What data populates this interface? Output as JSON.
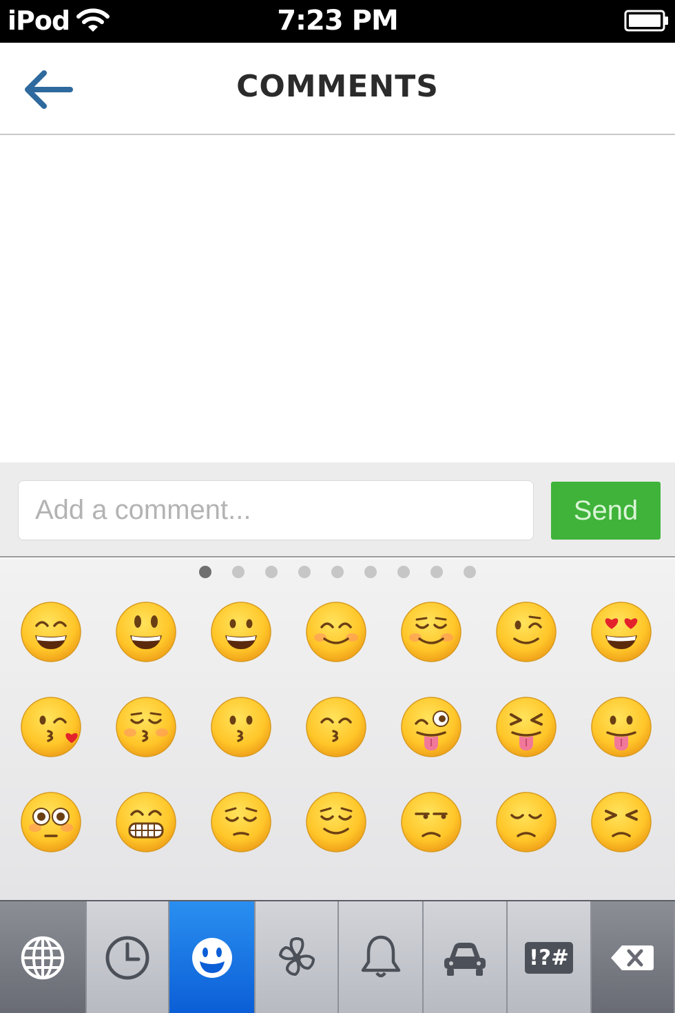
{
  "status_bar": {
    "carrier": "iPod",
    "time": "7:23 PM",
    "wifi_icon": "wifi-icon",
    "battery_icon": "battery-icon"
  },
  "nav_bar": {
    "title": "COMMENTS",
    "back_icon": "arrow-left-icon"
  },
  "comment_box": {
    "placeholder": "Add a comment...",
    "value": "",
    "send_label": "Send"
  },
  "emoji_keyboard": {
    "page_count": 9,
    "active_page": 1,
    "emojis": [
      "grinning-smiling-eyes",
      "smiley",
      "grinning",
      "blush",
      "relaxed",
      "wink",
      "heart-eyes",
      "kissing-heart",
      "kissing-closed-eyes",
      "kissing",
      "kissing-smiling-eyes",
      "stuck-out-tongue-winking-eye",
      "stuck-out-tongue-closed-eyes",
      "stuck-out-tongue",
      "flushed",
      "grimacing",
      "pensive",
      "relieved",
      "unamused",
      "disappointed",
      "persevere"
    ],
    "categories": [
      {
        "name": "globe",
        "icon": "globe-icon"
      },
      {
        "name": "recent",
        "icon": "clock-icon"
      },
      {
        "name": "people",
        "icon": "smiley-icon",
        "selected": true
      },
      {
        "name": "nature",
        "icon": "flower-icon"
      },
      {
        "name": "objects",
        "icon": "bell-icon"
      },
      {
        "name": "places",
        "icon": "car-icon"
      },
      {
        "name": "symbols",
        "icon": "symbols-icon",
        "label": "!?#"
      },
      {
        "name": "delete",
        "icon": "backspace-icon"
      }
    ]
  },
  "colors": {
    "send_green": "#3fb33a",
    "back_arrow": "#2f6a9e",
    "selected_key": "#1479e6"
  }
}
